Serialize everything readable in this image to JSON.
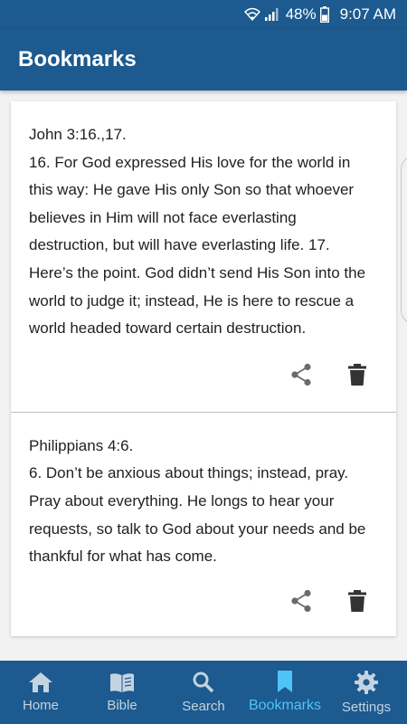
{
  "status_bar": {
    "battery": "48%",
    "time": "9:07 AM",
    "icons": [
      "wifi-icon",
      "signal-icon",
      "battery-icon"
    ]
  },
  "app_bar": {
    "title": "Bookmarks"
  },
  "bookmarks": [
    {
      "reference": "John 3:16.,17.",
      "text": "16. For God expressed His love for the world in this way: He gave His only Son so that whoever believes in Him will not face everlasting destruction, but will have everlasting life. 17. Here’s the point. God didn’t send His Son into the world to judge it; instead, He is here to rescue a world headed toward certain destruction."
    },
    {
      "reference": "Philippians 4:6.",
      "text": "6. Don’t be anxious about things; instead, pray. Pray about everything. He longs to hear your requests, so talk to God about your needs and be thankful for what has come."
    }
  ],
  "bottom_nav": {
    "items": [
      {
        "label": "Home",
        "icon": "home-icon",
        "active": false
      },
      {
        "label": "Bible",
        "icon": "book-icon",
        "active": false
      },
      {
        "label": "Search",
        "icon": "search-icon",
        "active": false
      },
      {
        "label": "Bookmarks",
        "icon": "bookmark-icon",
        "active": true
      },
      {
        "label": "Settings",
        "icon": "gear-icon",
        "active": false
      }
    ]
  },
  "colors": {
    "primary": "#1c5a8f",
    "active_tab": "#4fc3f7",
    "inactive_tab": "#c4d3e0",
    "background": "#f2f2f2"
  }
}
